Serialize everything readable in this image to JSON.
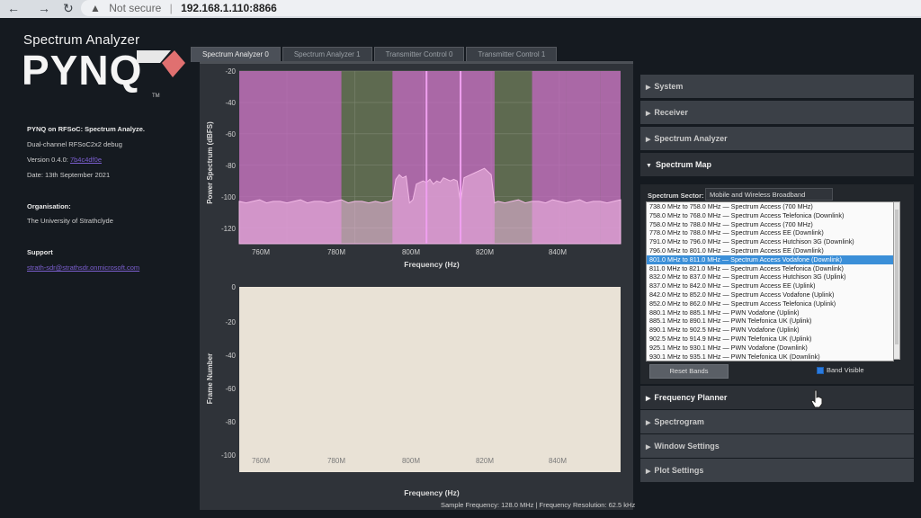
{
  "browser": {
    "security_label": "Not secure",
    "url": "192.168.1.110:8866"
  },
  "sidebar": {
    "logo_subtitle": "Spectrum Analyzer",
    "logo_title": "PYNQ",
    "logo_tm": "TM",
    "app_name": "PYNQ on RFSoC: Spectrum Analyze.",
    "board": "Dual-channel RFSoC2x2 debug",
    "version_label": "Version 0.4.0:",
    "version_link": "7b4c4df0e",
    "date": "Date: 13th September 2021",
    "organisation_heading": "Organisation:",
    "organisation": "The University of Strathclyde",
    "support_heading": "Support",
    "support_link": "strath-sdr@strathsdr.onmicrosoft.com"
  },
  "tabs": [
    {
      "label": "Spectrum Analyzer 0",
      "active": true
    },
    {
      "label": "Spectrum Analyzer 1",
      "active": false
    },
    {
      "label": "Transmitter Control 0",
      "active": false
    },
    {
      "label": "Transmitter Control 1",
      "active": false
    }
  ],
  "spectrum_plot": {
    "ylabel": "Power Spectrum (dBFS)",
    "xlabel": "Frequency (Hz)",
    "y_ticks": [
      "-20",
      "-40",
      "-60",
      "-80",
      "-100",
      "-120"
    ],
    "x_ticks": [
      "760M",
      "780M",
      "800M",
      "820M",
      "840M"
    ]
  },
  "spectrogram_plot": {
    "ylabel": "Frame Number",
    "xlabel": "Frequency (Hz)",
    "y_ticks": [
      "0",
      "-20",
      "-40",
      "-60",
      "-80",
      "-100"
    ],
    "x_ticks": [
      "760M",
      "780M",
      "800M",
      "820M",
      "840M"
    ]
  },
  "chart_data": {
    "type": "area",
    "x_unit": "MHz",
    "x_range": [
      746,
      858
    ],
    "y_range": [
      -130,
      -20
    ],
    "trace_color": "#f2b9e6",
    "band_color": "#c868c8",
    "band_highlight_color": "#f0a0f0",
    "noise_floor_dbfs": -103,
    "x": [
      746,
      748,
      750,
      752,
      754,
      756,
      758,
      760,
      762,
      764,
      766,
      768,
      770,
      772,
      774,
      776,
      778,
      780,
      782,
      784,
      786,
      788,
      790,
      791,
      792,
      793,
      794,
      795,
      796,
      797,
      798,
      799,
      800,
      801,
      802,
      803,
      804,
      805,
      806,
      807,
      808,
      809,
      810,
      811,
      812,
      813,
      814,
      815,
      816,
      817,
      818,
      819,
      820,
      821,
      822,
      824,
      826,
      828,
      830,
      832,
      834,
      836,
      838,
      840,
      842,
      844,
      846,
      848,
      850,
      852,
      854,
      856,
      858
    ],
    "y": [
      -103,
      -104,
      -103,
      -102,
      -104,
      -103,
      -103,
      -104,
      -103,
      -102,
      -104,
      -103,
      -103,
      -104,
      -103,
      -102,
      -104,
      -103,
      -103,
      -104,
      -103,
      -104,
      -103,
      -102,
      -89,
      -86,
      -88,
      -87,
      -104,
      -102,
      -92,
      -91,
      -90,
      -91,
      -89,
      -92,
      -90,
      -91,
      -88,
      -89,
      -90,
      -89,
      -90,
      -104,
      -88,
      -87,
      -86,
      -85,
      -84,
      -83,
      -82,
      -84,
      -86,
      -104,
      -103,
      -104,
      -103,
      -102,
      -104,
      -103,
      -103,
      -104,
      -102,
      -103,
      -104,
      -103,
      -102,
      -104,
      -103,
      -103,
      -104,
      -103,
      -102
    ],
    "bands": [
      {
        "start": 746,
        "end": 776
      },
      {
        "start": 791,
        "end": 801
      },
      {
        "start": 801,
        "end": 811
      },
      {
        "start": 811,
        "end": 821
      },
      {
        "start": 832,
        "end": 837
      },
      {
        "start": 837,
        "end": 842
      },
      {
        "start": 842,
        "end": 852
      },
      {
        "start": 852,
        "end": 862
      }
    ],
    "band_edges": [
      801,
      811
    ]
  },
  "settings": {
    "sections": [
      {
        "label": "System",
        "open": false
      },
      {
        "label": "Receiver",
        "open": false
      },
      {
        "label": "Spectrum Analyzer",
        "open": false
      },
      {
        "label": "Spectrum Map",
        "open": true
      },
      {
        "label": "Frequency Planner",
        "open": false
      },
      {
        "label": "Spectrogram",
        "open": false
      },
      {
        "label": "Window Settings",
        "open": false
      },
      {
        "label": "Plot Settings",
        "open": false
      }
    ],
    "sector_label": "Spectrum Sector:",
    "sector_value": "Mobile and Wireless Broadband",
    "bands": [
      "738.0 MHz to 758.0 MHz — Spectrum Access (700 MHz)",
      "758.0 MHz to 768.0 MHz — Spectrum Access Telefonica (Downlink)",
      "758.0 MHz to 788.0 MHz — Spectrum Access (700 MHz)",
      "778.0 MHz to 788.0 MHz — Spectrum Access EE (Downlink)",
      "791.0 MHz to 796.0 MHz — Spectrum Access Hutchison 3G (Downlink)",
      "796.0 MHz to 801.0 MHz — Spectrum Access EE (Downlink)",
      "801.0 MHz to 811.0 MHz — Spectrum Access Vodafone (Downlink)",
      "811.0 MHz to 821.0 MHz — Spectrum Access Telefonica (Downlink)",
      "832.0 MHz to 837.0 MHz — Spectrum Access Hutchison 3G (Uplink)",
      "837.0 MHz to 842.0 MHz — Spectrum Access EE (Uplink)",
      "842.0 MHz to 852.0 MHz — Spectrum Access Vodafone (Uplink)",
      "852.0 MHz to 862.0 MHz — Spectrum Access Telefonica (Uplink)",
      "880.1 MHz to 885.1 MHz — PWN Vodafone (Uplink)",
      "885.1 MHz to 890.1 MHz — PWN Telefonica UK (Uplink)",
      "890.1 MHz to 902.5 MHz — PWN Vodafone (Uplink)",
      "902.5 MHz to 914.9 MHz — PWN Telefonica UK (Uplink)",
      "925.1 MHz to 930.1 MHz — PWN Vodafone (Downlink)",
      "930.1 MHz to 935.1 MHz — PWN Telefonica UK (Downlink)"
    ],
    "selected_band_index": 6,
    "reset_button": "Reset Bands",
    "band_visible_label": "Band Visible",
    "band_visible_checked": true
  },
  "footer": {
    "status": "Sample Frequency: 128.0 MHz | Frequency Resolution: 62.5 kHz"
  }
}
